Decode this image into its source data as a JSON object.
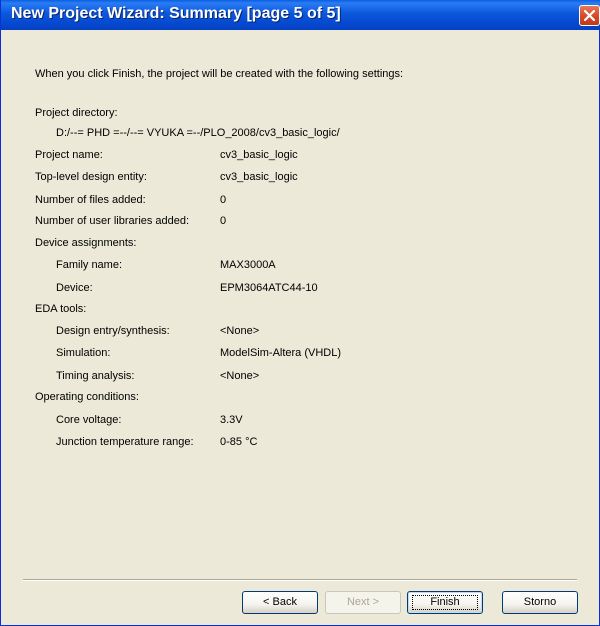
{
  "window": {
    "title": "New Project Wizard: Summary [page 5 of 5]"
  },
  "intro": "When you click Finish, the project will be created with the following settings:",
  "summary": {
    "project_directory_label": "Project directory:",
    "project_directory_value": "D:/--= PHD =--/--= VYUKA =--/PLO_2008/cv3_basic_logic/",
    "project_name_label": "Project name:",
    "project_name_value": "cv3_basic_logic",
    "top_level_label": "Top-level design entity:",
    "top_level_value": "cv3_basic_logic",
    "files_added_label": "Number of files added:",
    "files_added_value": "0",
    "user_libraries_label": "Number of user libraries added:",
    "user_libraries_value": "0",
    "device_assignments_label": "Device assignments:",
    "family_label": "Family name:",
    "family_value": "MAX3000A",
    "device_label": "Device:",
    "device_value": "EPM3064ATC44-10",
    "eda_tools_label": "EDA tools:",
    "design_entry_label": "Design entry/synthesis:",
    "design_entry_value": "<None>",
    "simulation_label": "Simulation:",
    "simulation_value": "ModelSim-Altera (VHDL)",
    "timing_label": "Timing analysis:",
    "timing_value": "<None>",
    "operating_conditions_label": "Operating conditions:",
    "core_voltage_label": "Core voltage:",
    "core_voltage_value": "3.3V",
    "junction_temp_label": "Junction temperature range:",
    "junction_temp_value": "0-85 °C"
  },
  "buttons": {
    "back": "< Back",
    "next": "Next >",
    "finish": "Finish",
    "cancel": "Storno"
  },
  "colors": {
    "titlebar": "#0b58dc",
    "dialog_bg": "#ece9d8",
    "close_button": "#d74b2a"
  }
}
